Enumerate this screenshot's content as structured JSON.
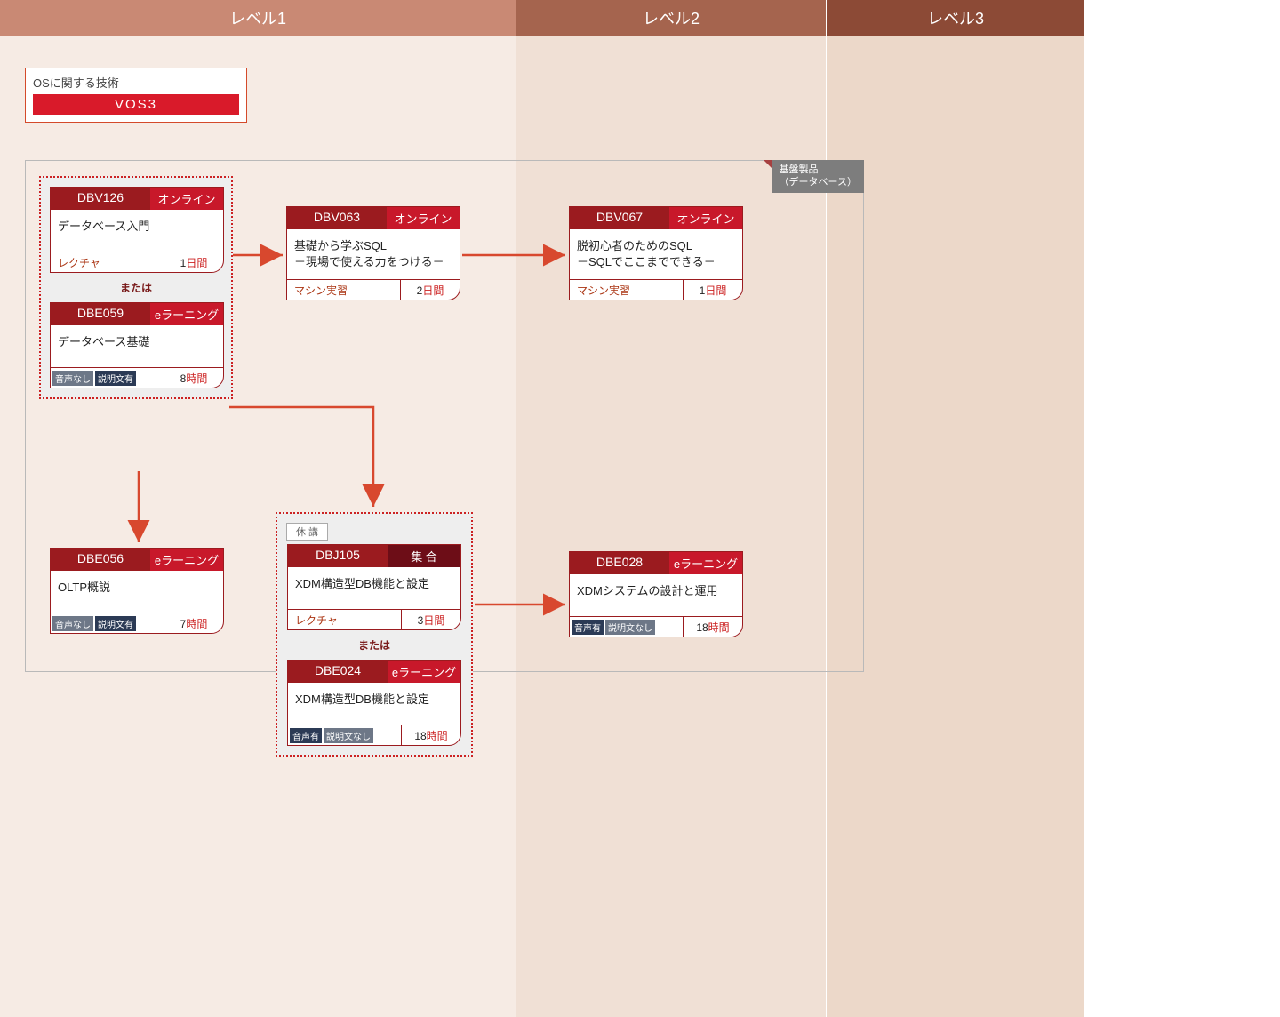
{
  "levels": {
    "l1": "レベル1",
    "l2": "レベル2",
    "l3": "レベル3"
  },
  "sidebox": {
    "title": "OSに関する技術",
    "tag": "VOS3"
  },
  "frame_label_l1": "基盤製品",
  "frame_label_l2": "（データベース）",
  "or_label": "または",
  "status_closed": "休 講",
  "footer_units": {
    "day": "日間",
    "hour": "時間"
  },
  "format_labels": {
    "lecture": "レクチャ",
    "machine": "マシン実習"
  },
  "type_labels": {
    "online": "オンライン",
    "elearn": "eラーニング",
    "shugo": "集 合"
  },
  "audio": {
    "yes": "音声有",
    "no": "音声なし"
  },
  "desc": {
    "yes": "説明文有",
    "no": "説明文なし"
  },
  "courses": {
    "dbv126": {
      "code": "DBV126",
      "type": "online",
      "title": "データベース入門",
      "format": "lecture",
      "dur_n": "1",
      "dur_u": "day"
    },
    "dbe059": {
      "code": "DBE059",
      "type": "elearn",
      "title": "データベース基礎",
      "audio": "no",
      "desc": "yes",
      "dur_n": "8",
      "dur_u": "hour"
    },
    "dbv063": {
      "code": "DBV063",
      "type": "online",
      "title_l1": "基礎から学ぶSQL",
      "title_l2": "－現場で使える力をつける－",
      "format": "machine",
      "dur_n": "2",
      "dur_u": "day"
    },
    "dbv067": {
      "code": "DBV067",
      "type": "online",
      "title_l1": "脱初心者のためのSQL",
      "title_l2": "－SQLでここまでできる－",
      "format": "machine",
      "dur_n": "1",
      "dur_u": "day"
    },
    "dbe056": {
      "code": "DBE056",
      "type": "elearn",
      "title": "OLTP概説",
      "audio": "no",
      "desc": "yes",
      "dur_n": "7",
      "dur_u": "hour"
    },
    "dbj105": {
      "code": "DBJ105",
      "type": "shugo",
      "title": "XDM構造型DB機能と設定",
      "format": "lecture",
      "dur_n": "3",
      "dur_u": "day",
      "status": "closed"
    },
    "dbe024": {
      "code": "DBE024",
      "type": "elearn",
      "title": "XDM構造型DB機能と設定",
      "audio": "yes",
      "desc": "no",
      "dur_n": "18",
      "dur_u": "hour"
    },
    "dbe028": {
      "code": "DBE028",
      "type": "elearn",
      "title": "XDMシステムの設計と運用",
      "audio": "yes",
      "desc": "no",
      "dur_n": "18",
      "dur_u": "hour"
    }
  }
}
